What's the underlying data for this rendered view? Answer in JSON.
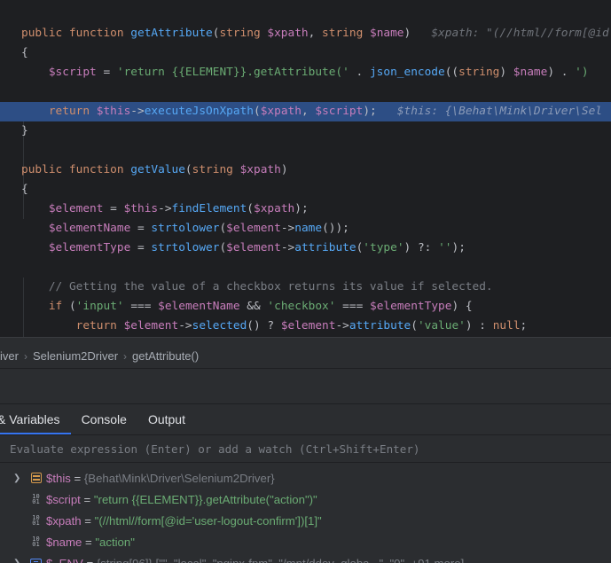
{
  "editor": {
    "lines": [
      {
        "id": "l1",
        "tokens": [
          [
            "k",
            "public function "
          ],
          [
            "fn",
            "getAttribute"
          ],
          [
            "p",
            "("
          ],
          [
            "k",
            "string "
          ],
          [
            "v",
            "$xpath"
          ],
          [
            "p",
            ", "
          ],
          [
            "k",
            "string "
          ],
          [
            "v",
            "$name"
          ],
          [
            "p",
            ")  "
          ],
          [
            "hint",
            " $xpath: \"(//html//form[@id"
          ]
        ]
      },
      {
        "id": "l2",
        "tokens": [
          [
            "p",
            "{"
          ]
        ]
      },
      {
        "id": "l3",
        "tokens": [
          [
            "p",
            "    "
          ],
          [
            "v",
            "$script"
          ],
          [
            "p",
            " = "
          ],
          [
            "s",
            "'return {{ELEMENT}}.getAttribute('"
          ],
          [
            "p",
            " . "
          ],
          [
            "fn",
            "json_encode"
          ],
          [
            "p",
            "(("
          ],
          [
            "k",
            "string"
          ],
          [
            "p",
            ") "
          ],
          [
            "v",
            "$name"
          ],
          [
            "p",
            ") . "
          ],
          [
            "s",
            "')"
          ]
        ]
      },
      {
        "id": "l4",
        "tokens": []
      },
      {
        "id": "l5",
        "tokens": [
          [
            "p",
            "    "
          ],
          [
            "k",
            "return "
          ],
          [
            "v",
            "$this"
          ],
          [
            "p",
            "->"
          ],
          [
            "fn",
            "executeJsOnXpath"
          ],
          [
            "p",
            "("
          ],
          [
            "v",
            "$xpath"
          ],
          [
            "p",
            ", "
          ],
          [
            "v",
            "$script"
          ],
          [
            "p",
            ");  "
          ],
          [
            "hint",
            " $this: {\\Behat\\Mink\\Driver\\Sel"
          ]
        ]
      },
      {
        "id": "l6",
        "tokens": [
          [
            "p",
            "}"
          ]
        ]
      },
      {
        "id": "l7",
        "tokens": []
      },
      {
        "id": "l8",
        "tokens": [
          [
            "k",
            "public function "
          ],
          [
            "fn",
            "getValue"
          ],
          [
            "p",
            "("
          ],
          [
            "k",
            "string "
          ],
          [
            "v",
            "$xpath"
          ],
          [
            "p",
            ")"
          ]
        ]
      },
      {
        "id": "l9",
        "tokens": [
          [
            "p",
            "{"
          ]
        ]
      },
      {
        "id": "l10",
        "tokens": [
          [
            "p",
            "    "
          ],
          [
            "v",
            "$element"
          ],
          [
            "p",
            " = "
          ],
          [
            "v",
            "$this"
          ],
          [
            "p",
            "->"
          ],
          [
            "fn",
            "findElement"
          ],
          [
            "p",
            "("
          ],
          [
            "v",
            "$xpath"
          ],
          [
            "p",
            ");"
          ]
        ]
      },
      {
        "id": "l11",
        "tokens": [
          [
            "p",
            "    "
          ],
          [
            "v",
            "$elementName"
          ],
          [
            "p",
            " = "
          ],
          [
            "fn",
            "strtolower"
          ],
          [
            "p",
            "("
          ],
          [
            "v",
            "$element"
          ],
          [
            "p",
            "->"
          ],
          [
            "fn",
            "name"
          ],
          [
            "p",
            "());"
          ]
        ]
      },
      {
        "id": "l12",
        "tokens": [
          [
            "p",
            "    "
          ],
          [
            "v",
            "$elementType"
          ],
          [
            "p",
            " = "
          ],
          [
            "fn",
            "strtolower"
          ],
          [
            "p",
            "("
          ],
          [
            "v",
            "$element"
          ],
          [
            "p",
            "->"
          ],
          [
            "fn",
            "attribute"
          ],
          [
            "p",
            "("
          ],
          [
            "s",
            "'type'"
          ],
          [
            "p",
            ") ?: "
          ],
          [
            "s",
            "''"
          ],
          [
            "p",
            ");"
          ]
        ]
      },
      {
        "id": "l13",
        "tokens": []
      },
      {
        "id": "l14",
        "tokens": [
          [
            "p",
            "    "
          ],
          [
            "cm",
            "// Getting the value of a checkbox returns its value if selected."
          ]
        ]
      },
      {
        "id": "l15",
        "tokens": [
          [
            "p",
            "    "
          ],
          [
            "k",
            "if "
          ],
          [
            "p",
            "("
          ],
          [
            "s",
            "'input'"
          ],
          [
            "p",
            " === "
          ],
          [
            "v",
            "$elementName"
          ],
          [
            "p",
            " && "
          ],
          [
            "s",
            "'checkbox'"
          ],
          [
            "p",
            " === "
          ],
          [
            "v",
            "$elementType"
          ],
          [
            "p",
            ") {"
          ]
        ]
      },
      {
        "id": "l16",
        "tokens": [
          [
            "p",
            "        "
          ],
          [
            "k",
            "return "
          ],
          [
            "v",
            "$element"
          ],
          [
            "p",
            "->"
          ],
          [
            "fn",
            "selected"
          ],
          [
            "p",
            "() ? "
          ],
          [
            "v",
            "$element"
          ],
          [
            "p",
            "->"
          ],
          [
            "fn",
            "attribute"
          ],
          [
            "p",
            "("
          ],
          [
            "s",
            "'value'"
          ],
          [
            "p",
            ") : "
          ],
          [
            "k",
            "null"
          ],
          [
            "p",
            ";"
          ]
        ]
      },
      {
        "id": "l17",
        "tokens": [
          [
            "p",
            "    }"
          ]
        ]
      }
    ],
    "execution_line": "l5"
  },
  "breadcrumb": {
    "items": [
      "iver",
      "Selenium2Driver",
      "getAttribute()"
    ]
  },
  "debug": {
    "tabs": [
      {
        "label": "& Variables",
        "active": true
      },
      {
        "label": "Console",
        "active": false
      },
      {
        "label": "Output",
        "active": false
      }
    ],
    "evaluate_placeholder": "Evaluate expression (Enter) or add a watch (Ctrl+Shift+Enter)",
    "variables": [
      {
        "name": "$this",
        "value": "{Behat\\Mink\\Driver\\Selenium2Driver}",
        "kind": "object",
        "expandable": true,
        "value_style": "type"
      },
      {
        "name": "$script",
        "value": "\"return {{ELEMENT}}.getAttribute(\"action\")\"",
        "kind": "scalar",
        "expandable": false,
        "value_style": "string"
      },
      {
        "name": "$xpath",
        "value": "\"(//html//form[@id='user-logout-confirm'])[1]\"",
        "kind": "scalar",
        "expandable": false,
        "value_style": "string"
      },
      {
        "name": "$name",
        "value": "\"action\"",
        "kind": "scalar",
        "expandable": false,
        "value_style": "string"
      },
      {
        "name": "$_ENV",
        "value": "{string[96]} [\"\", \"local\", \"nginx-fpm\", \"/mnt/ddev_globa...\", \"0\", +91 more]",
        "kind": "array",
        "expandable": true,
        "value_style": "type"
      }
    ]
  },
  "colors": {
    "editor_bg": "#1e1f22",
    "panel_bg": "#2b2d30",
    "execution_line": "#2d4e85",
    "keyword": "#cf8e6d",
    "function": "#56a8f5",
    "variable": "#c77dbb",
    "string": "#6aab73",
    "comment": "#7a7e85",
    "tab_underline": "#3574f0"
  }
}
